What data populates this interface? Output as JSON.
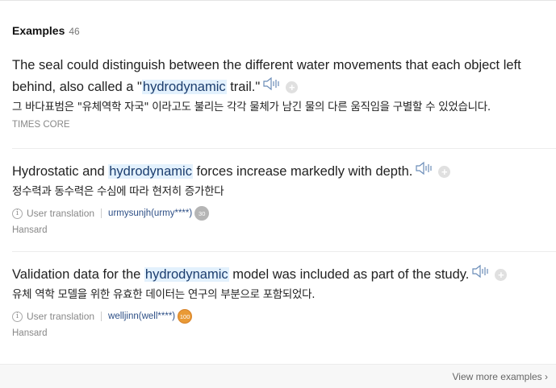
{
  "header": {
    "title": "Examples",
    "count": "46"
  },
  "examples": [
    {
      "en_pre": "The seal could distinguish between the different water movements that each object left behind, also called a \"",
      "keyword": "hydrodynamic",
      "en_post": " trail.\"",
      "ko": "그 바다표범은 \"유체역학 자국\" 이라고도 불리는 각각 물체가 남긴 물의 다른 움직임을 구별할 수 있었습니다.",
      "source": "TIMES CORE"
    },
    {
      "en_pre": "Hydrostatic and ",
      "keyword": "hydrodynamic",
      "en_post": " forces increase markedly with depth.",
      "ko": "정수력과 동수력은 수심에 따라 현저히 증가한다",
      "user_label": "User translation",
      "user_name": "urmysunjh(urmy****)",
      "badge": "30",
      "source": "Hansard"
    },
    {
      "en_pre": "Validation data for the ",
      "keyword": "hydrodynamic",
      "en_post": " model was included as part of the study.",
      "ko": "유체 역학 모델을 위한 유효한 데이터는 연구의 부분으로 포함되었다.",
      "user_label": "User translation",
      "user_name": "welljinn(well****)",
      "badge": "100",
      "source": "Hansard"
    }
  ],
  "footer": {
    "more_label": "View more examples ›"
  },
  "icons": {
    "speaker": "speaker-icon",
    "plus": "add-icon",
    "info": "info-icon"
  },
  "colors": {
    "highlight_bg": "#e3f1fd",
    "user_link": "#2d4f86",
    "badge_orange": "#e99a36",
    "badge_grey": "#b5b5b5"
  }
}
